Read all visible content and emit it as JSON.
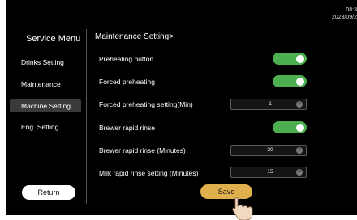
{
  "clock": {
    "time": "08:3",
    "date": "2023/09/2"
  },
  "sidebar": {
    "title": "Service Menu",
    "items": [
      {
        "label": "Drinks Setting",
        "active": false
      },
      {
        "label": "Maintenance",
        "active": false
      },
      {
        "label": "Machine Setting",
        "active": true
      },
      {
        "label": "Eng. Setting",
        "active": false
      }
    ],
    "return_label": "Return"
  },
  "main": {
    "section_title": "Maintenance Setting>",
    "rows": [
      {
        "label": "Preheating button",
        "type": "toggle",
        "on": true
      },
      {
        "label": "Forced preheating",
        "type": "toggle",
        "on": true
      },
      {
        "label": "Forced preheating setting(Min)",
        "type": "stepper",
        "value": "1"
      },
      {
        "label": "Brewer rapid rinse",
        "type": "toggle",
        "on": true
      },
      {
        "label": "Brewer rapid rinse (Minutes)",
        "type": "stepper",
        "value": "20"
      },
      {
        "label": "Milk rapid rinse setting (Minutes)",
        "type": "stepper",
        "value": "15"
      }
    ],
    "save_label": "Save"
  },
  "colors": {
    "toggle_on": "#4caf50",
    "save_button": "#e0b04c",
    "background": "#000000",
    "active_menu": "#3a3a3a"
  },
  "icons": {
    "stepper_clear": "circle-x-icon",
    "pointer": "hand-pointer-icon"
  }
}
